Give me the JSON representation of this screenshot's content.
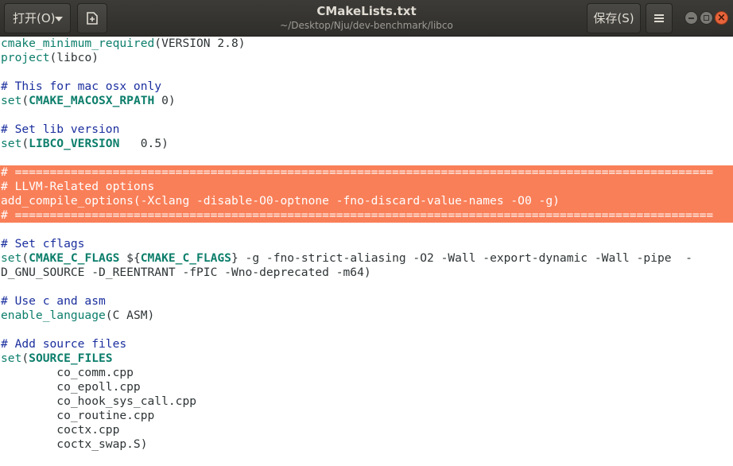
{
  "toolbar": {
    "open_label": "打开(O)",
    "save_label": "保存(S)",
    "title": "CMakeLists.txt",
    "path": "~/Desktop/Nju/dev-benchmark/libco"
  },
  "icons": {
    "new_document": "new-document-icon",
    "menu": "hamburger-menu-icon",
    "minimize": "minimize-icon",
    "maximize": "maximize-icon",
    "close": "close-icon"
  },
  "colors": {
    "highlight_background": "#f97f58",
    "keyword": "#0c7e6b",
    "comment": "#1b2f9e",
    "close_button": "#e8643b"
  },
  "editor": {
    "lines": [
      {
        "highlight": false,
        "segments": [
          {
            "t": "kw",
            "v": "cmake_minimum_required"
          },
          {
            "t": "txt",
            "v": "(VERSION 2.8)"
          }
        ]
      },
      {
        "highlight": false,
        "segments": [
          {
            "t": "kw",
            "v": "project"
          },
          {
            "t": "txt",
            "v": "(libco)"
          }
        ]
      },
      {
        "highlight": false,
        "segments": []
      },
      {
        "highlight": false,
        "segments": [
          {
            "t": "cmt",
            "v": "# This for mac osx only"
          }
        ]
      },
      {
        "highlight": false,
        "segments": [
          {
            "t": "kw",
            "v": "set"
          },
          {
            "t": "txt",
            "v": "("
          },
          {
            "t": "var",
            "v": "CMAKE_MACOSX_RPATH"
          },
          {
            "t": "txt",
            "v": " 0)"
          }
        ]
      },
      {
        "highlight": false,
        "segments": []
      },
      {
        "highlight": false,
        "segments": [
          {
            "t": "cmt",
            "v": "# Set lib version"
          }
        ]
      },
      {
        "highlight": false,
        "segments": [
          {
            "t": "kw",
            "v": "set"
          },
          {
            "t": "txt",
            "v": "("
          },
          {
            "t": "var",
            "v": "LIBCO_VERSION"
          },
          {
            "t": "txt",
            "v": "   0.5)"
          }
        ]
      },
      {
        "highlight": false,
        "segments": []
      },
      {
        "highlight": true,
        "segments": [
          {
            "t": "cmt",
            "v": "# ===================================================================================================="
          }
        ]
      },
      {
        "highlight": true,
        "segments": [
          {
            "t": "cmt",
            "v": "# LLVM-Related options"
          }
        ]
      },
      {
        "highlight": true,
        "segments": [
          {
            "t": "txt",
            "v": "add_compile_options(-Xclang -disable-O0-optnone -fno-discard-value-names -O0 -g)"
          }
        ]
      },
      {
        "highlight": true,
        "cursor": true,
        "segments": [
          {
            "t": "cmt",
            "v": "# ===================================================================================================="
          }
        ]
      },
      {
        "highlight": false,
        "segments": []
      },
      {
        "highlight": false,
        "segments": [
          {
            "t": "cmt",
            "v": "# Set cflags"
          }
        ]
      },
      {
        "highlight": false,
        "segments": [
          {
            "t": "kw",
            "v": "set"
          },
          {
            "t": "txt",
            "v": "("
          },
          {
            "t": "var",
            "v": "CMAKE_C_FLAGS"
          },
          {
            "t": "txt",
            "v": " ${"
          },
          {
            "t": "var",
            "v": "CMAKE_C_FLAGS"
          },
          {
            "t": "txt",
            "v": "} -g -fno-strict-aliasing -O2 -Wall -export-dynamic -Wall -pipe  -"
          }
        ]
      },
      {
        "highlight": false,
        "segments": [
          {
            "t": "txt",
            "v": "D_GNU_SOURCE -D_REENTRANT -fPIC -Wno-deprecated -m64)"
          }
        ]
      },
      {
        "highlight": false,
        "segments": []
      },
      {
        "highlight": false,
        "segments": [
          {
            "t": "cmt",
            "v": "# Use c and asm"
          }
        ]
      },
      {
        "highlight": false,
        "segments": [
          {
            "t": "kw",
            "v": "enable_language"
          },
          {
            "t": "txt",
            "v": "(C ASM)"
          }
        ]
      },
      {
        "highlight": false,
        "segments": []
      },
      {
        "highlight": false,
        "segments": [
          {
            "t": "cmt",
            "v": "# Add source files"
          }
        ]
      },
      {
        "highlight": false,
        "segments": [
          {
            "t": "kw",
            "v": "set"
          },
          {
            "t": "txt",
            "v": "("
          },
          {
            "t": "var",
            "v": "SOURCE_FILES"
          }
        ]
      },
      {
        "highlight": false,
        "segments": [
          {
            "t": "txt",
            "v": "        co_comm.cpp"
          }
        ]
      },
      {
        "highlight": false,
        "segments": [
          {
            "t": "txt",
            "v": "        co_epoll.cpp"
          }
        ]
      },
      {
        "highlight": false,
        "segments": [
          {
            "t": "txt",
            "v": "        co_hook_sys_call.cpp"
          }
        ]
      },
      {
        "highlight": false,
        "segments": [
          {
            "t": "txt",
            "v": "        co_routine.cpp"
          }
        ]
      },
      {
        "highlight": false,
        "segments": [
          {
            "t": "txt",
            "v": "        coctx.cpp"
          }
        ]
      },
      {
        "highlight": false,
        "segments": [
          {
            "t": "txt",
            "v": "        coctx_swap.S)"
          }
        ]
      }
    ]
  }
}
